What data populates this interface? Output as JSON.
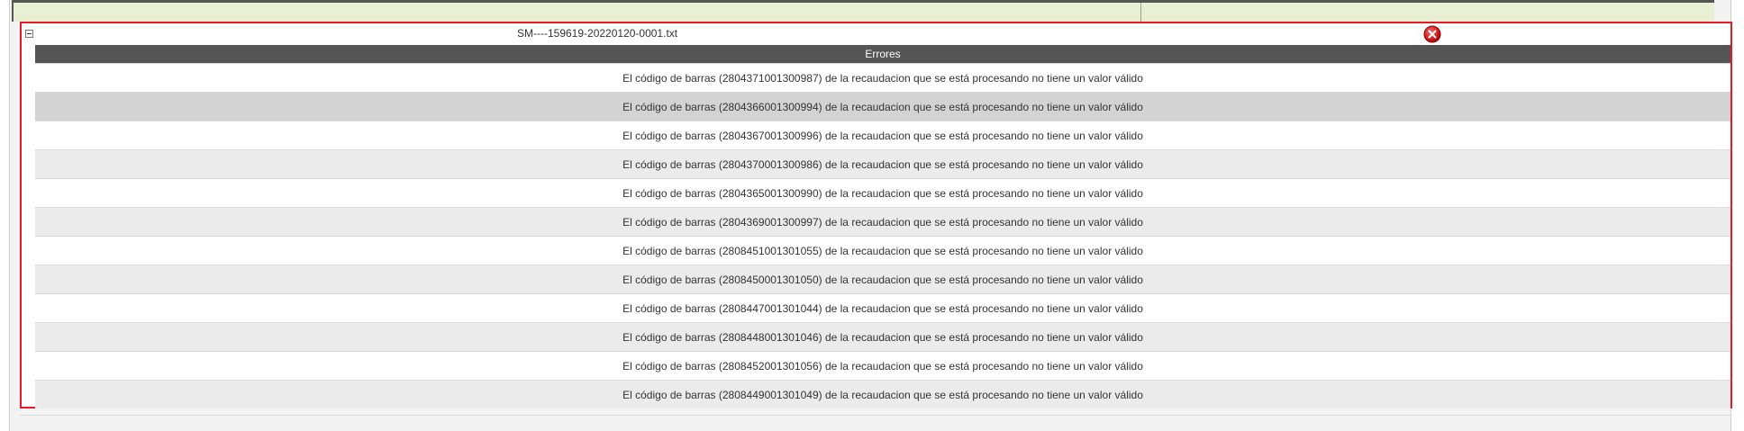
{
  "panel": {
    "file_name": "SM----159619-20220120-0001.txt",
    "toggle_icon": "collapse-minus-icon",
    "delete_icon": "red-close-circle-icon"
  },
  "errors": {
    "header": "Errores",
    "rows": [
      "El código de barras (2804371001300987) de la recaudacion que se está procesando no tiene un valor válido",
      "El código de barras (2804366001300994) de la recaudacion que se está procesando no tiene un valor válido",
      "El código de barras (2804367001300996) de la recaudacion que se está procesando no tiene un valor válido",
      "El código de barras (2804370001300986) de la recaudacion que se está procesando no tiene un valor válido",
      "El código de barras (2804365001300990) de la recaudacion que se está procesando no tiene un valor válido",
      "El código de barras (2804369001300997) de la recaudacion que se está procesando no tiene un valor válido",
      "El código de barras (2808451001301055) de la recaudacion que se está procesando no tiene un valor válido",
      "El código de barras (2808450001301050) de la recaudacion que se está procesando no tiene un valor válido",
      "El código de barras (2808447001301044) de la recaudacion que se está procesando no tiene un valor válido",
      "El código de barras (2808448001301046) de la recaudacion que se está procesando no tiene un valor válido",
      "El código de barras (2808452001301056) de la recaudacion que se está procesando no tiene un valor válido",
      "El código de barras (2808449001301049) de la recaudacion que se está procesando no tiene un valor válido"
    ]
  },
  "colors": {
    "panel_border": "#e31b23",
    "header_bg": "#555555",
    "row_alt": "#ebebeb",
    "row_selected": "#d3d3d3",
    "top_bar": "#e9efd2"
  }
}
